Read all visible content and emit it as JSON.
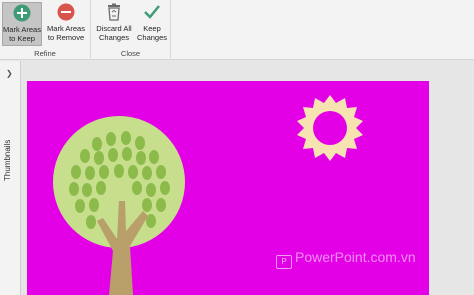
{
  "ribbon": {
    "refine": {
      "label": "Refine",
      "keep_label": "Mark Areas\nto Keep",
      "keep_icon": "plus-circle-icon",
      "remove_label": "Mark Areas\nto Remove",
      "remove_icon": "minus-circle-icon"
    },
    "close": {
      "label": "Close",
      "discard_label": "Discard All\nChanges",
      "discard_icon": "recycle-bin-icon",
      "keep_changes_label": "Keep\nChanges",
      "keep_changes_icon": "checkmark-icon"
    }
  },
  "side_panel": {
    "label": "Thumbnails",
    "arrow_icon": "chevron-right-icon"
  },
  "slide": {
    "background_color": "#e300e6",
    "watermark_text": "PowerPoint.com.vn"
  }
}
